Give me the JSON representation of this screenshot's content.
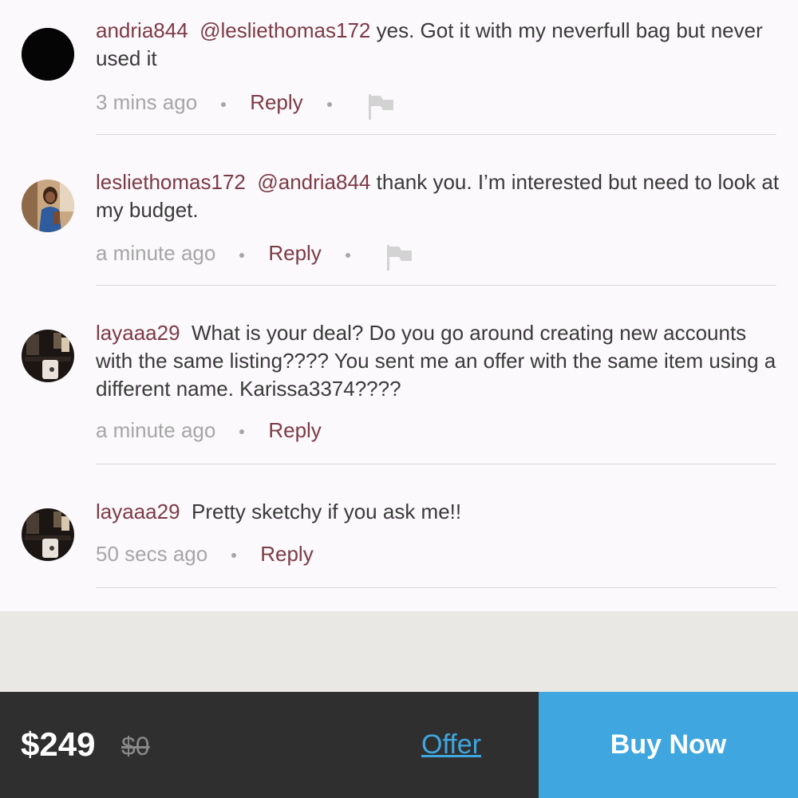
{
  "comments": [
    {
      "username": "andria844",
      "mention": "@lesliethomas172",
      "text": "yes. Got it with my neverfull bag but never used it",
      "time": "3 mins ago",
      "reply_label": "Reply",
      "avatar": "black-avatar",
      "has_flag": true
    },
    {
      "username": "lesliethomas172",
      "mention": "@andria844",
      "text": "thank you. I’m interested but need to look at my budget.",
      "time": "a minute ago",
      "reply_label": "Reply",
      "avatar": "photo-avatar-woman",
      "has_flag": true
    },
    {
      "username": "layaaa29",
      "mention": "",
      "text": "What is your deal? Do you go around creating new accounts with the same listing???? You sent me an offer with the same item using a different name. Karissa3374????",
      "time": "a minute ago",
      "reply_label": "Reply",
      "avatar": "photo-avatar-dark",
      "has_flag": false
    },
    {
      "username": "layaaa29",
      "mention": "",
      "text": "Pretty sketchy if you ask me!!",
      "time": "50 secs ago",
      "reply_label": "Reply",
      "avatar": "photo-avatar-dark",
      "has_flag": false
    }
  ],
  "bottom_bar": {
    "price": "$249",
    "original_price": "$0",
    "offer_label": "Offer",
    "buy_label": "Buy Now"
  },
  "colors": {
    "username": "#7d3a48",
    "accent_blue": "#40a6e0",
    "bar_dark": "#2f2f2f"
  }
}
